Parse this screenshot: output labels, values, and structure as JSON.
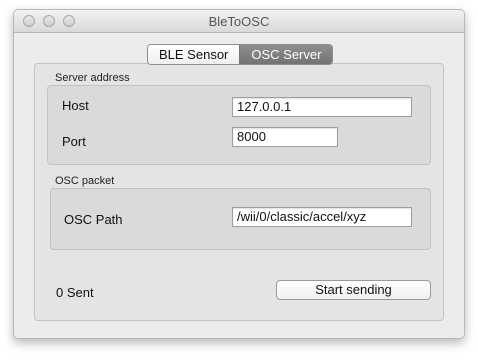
{
  "window": {
    "title": "BleToOSC"
  },
  "tabs": [
    {
      "label": "BLE Sensor",
      "selected": false
    },
    {
      "label": "OSC Server",
      "selected": true
    }
  ],
  "server_address": {
    "group_label": "Server address",
    "host_label": "Host",
    "host_value": "127.0.0.1",
    "port_label": "Port",
    "port_value": "8000"
  },
  "osc_packet": {
    "group_label": "OSC packet",
    "path_label": "OSC Path",
    "path_value": "/wii/0/classic/accel/xyz"
  },
  "footer": {
    "sent_status": "0 Sent",
    "start_button_label": "Start sending"
  }
}
